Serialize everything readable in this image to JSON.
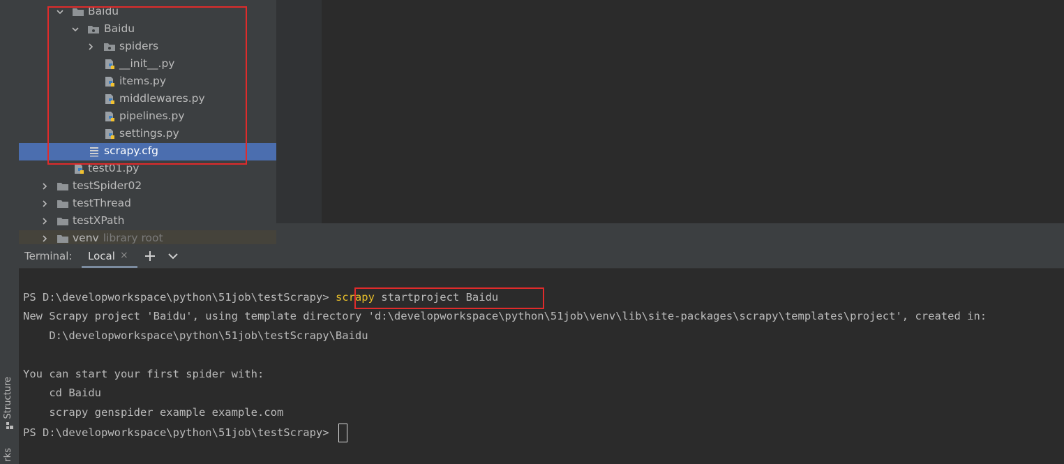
{
  "sidebar": {
    "structure_label": "Structure",
    "bookmarks_label": "rks"
  },
  "tree": {
    "baidu_outer": "Baidu",
    "baidu_inner": "Baidu",
    "spiders": "spiders",
    "init_py": "__init__.py",
    "items_py": "items.py",
    "middlewares_py": "middlewares.py",
    "pipelines_py": "pipelines.py",
    "settings_py": "settings.py",
    "scrapy_cfg": "scrapy.cfg",
    "test01_py": "test01.py",
    "testspider02": "testSpider02",
    "testthread": "testThread",
    "testxpath": "testXPath",
    "venv": "venv",
    "venv_hint": "library root"
  },
  "terminal": {
    "title": "Terminal:",
    "tab_label": "Local",
    "tab_close": "×",
    "add_button": "+",
    "dropdown_button": "⌄",
    "lines": {
      "prompt1": "PS D:\\developworkspace\\python\\51job\\testScrapy> ",
      "cmd_keyword": "scrapy",
      "cmd_rest": " startproject Baidu",
      "created_line": "New Scrapy project 'Baidu', using template directory 'd:\\developworkspace\\python\\51job\\venv\\lib\\site-packages\\scrapy\\templates\\project', created in:",
      "created_path": "    D:\\developworkspace\\python\\51job\\testScrapy\\Baidu",
      "start_hint": "You can start your first spider with:",
      "cd_cmd": "    cd Baidu",
      "genspider_cmd": "    scrapy genspider example example.com",
      "prompt2": "PS D:\\developworkspace\\python\\51job\\testScrapy> "
    }
  },
  "colors": {
    "selection": "#4b6eaf",
    "highlight_box": "#e02b2b",
    "keyword": "#e8bf2a",
    "background": "#2b2b2b",
    "panel": "#3c3f41"
  }
}
